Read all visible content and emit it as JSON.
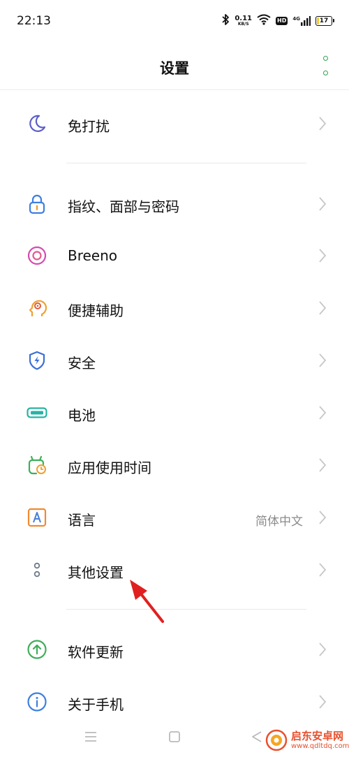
{
  "status_bar": {
    "time": "22:13",
    "net_speed_value": "0.11",
    "net_speed_unit": "KB/S",
    "hd_badge": "HD",
    "network_type": "4G",
    "battery_level": "17",
    "battery_fraction": 0.17
  },
  "header": {
    "title": "设置",
    "more_icon": "more-vertical-icon",
    "accent_color": "#2fa352"
  },
  "settings": {
    "items": [
      {
        "label": "免打扰",
        "icon": "moon-icon",
        "color": "#5b5fc7"
      },
      {
        "label": "指纹、面部与密码",
        "icon": "lock-icon",
        "color": "#3d7fe0"
      },
      {
        "label": "Breeno",
        "icon": "breeno-icon",
        "color": "#d34bb0"
      },
      {
        "label": "便捷辅助",
        "icon": "head-gesture-icon",
        "color": "#f0a030"
      },
      {
        "label": "安全",
        "icon": "shield-bolt-icon",
        "color": "#3a6fd6"
      },
      {
        "label": "电池",
        "icon": "battery-icon",
        "color": "#26b3a3"
      },
      {
        "label": "应用使用时间",
        "icon": "app-timer-icon",
        "color": "#3fae5a"
      },
      {
        "label": "语言",
        "value": "简体中文",
        "icon": "language-a-icon",
        "color": "#f08a30"
      },
      {
        "label": "其他设置",
        "icon": "other-settings-icon",
        "color": "#6d7a8a"
      },
      {
        "label": "软件更新",
        "icon": "update-arrow-icon",
        "color": "#3fae5a"
      },
      {
        "label": "关于手机",
        "icon": "info-icon",
        "color": "#3d7fe0"
      }
    ]
  },
  "annotation": {
    "arrow_color": "#e02020"
  },
  "nav_bar": {
    "menu_icon": "menu-icon",
    "home_icon": "home-square-icon",
    "back_icon": "back-triangle-icon"
  },
  "watermark": {
    "name": "启东安卓网",
    "url": "www.qdltdq.com"
  }
}
